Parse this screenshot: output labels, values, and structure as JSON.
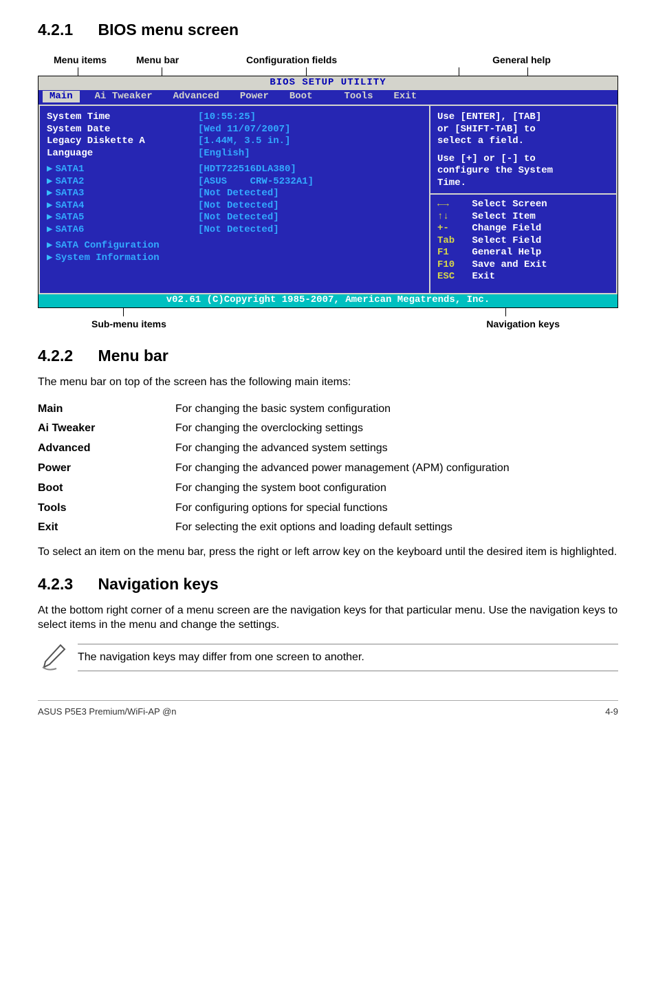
{
  "section1": {
    "num": "4.2.1",
    "title": "BIOS menu screen"
  },
  "topLabels": {
    "menuItems": "Menu items",
    "menuBar": "Menu bar",
    "configFields": "Configuration fields",
    "generalHelp": "General help"
  },
  "bios": {
    "title": "BIOS SETUP UTILITY",
    "tabs": {
      "main": "Main",
      "ai": "Ai Tweaker",
      "adv": "Advanced",
      "power": "Power",
      "boot": "Boot",
      "tools": "Tools",
      "exit": "Exit"
    },
    "left": {
      "sysTime": {
        "k": "System Time",
        "v": "[10:55:25]"
      },
      "sysDate": {
        "k": "System Date",
        "v": "[Wed 11/07/2007]"
      },
      "legacy": {
        "k": "Legacy Diskette A",
        "v": "[1.44M, 3.5 in.]"
      },
      "lang": {
        "k": "Language",
        "v": "[English]"
      },
      "sata1": {
        "k": "SATA1",
        "v": "[HDT722516DLA380]"
      },
      "sata2": {
        "k": "SATA2",
        "v": "[ASUS    CRW-5232A1]"
      },
      "sata3": {
        "k": "SATA3",
        "v": "[Not Detected]"
      },
      "sata4": {
        "k": "SATA4",
        "v": "[Not Detected]"
      },
      "sata5": {
        "k": "SATA5",
        "v": "[Not Detected]"
      },
      "sata6": {
        "k": "SATA6",
        "v": "[Not Detected]"
      },
      "sataCfg": "SATA Configuration",
      "sysInfo": "System Information"
    },
    "right": {
      "help1": "Use [ENTER], [TAB]",
      "help2": "or [SHIFT-TAB] to",
      "help3": "select a field.",
      "help4": "Use [+] or [-] to",
      "help5": "configure the System",
      "help6": "Time.",
      "nav": {
        "selScreen": "Select Screen",
        "selItem": "Select Item",
        "chField": "Change Field",
        "selField": "Select Field",
        "genHelp": "General Help",
        "saveExit": "Save and Exit",
        "exit": "Exit",
        "k_lr": "←→",
        "k_ud": "↑↓",
        "k_pm": "+-",
        "k_tab": "Tab",
        "k_f1": "F1",
        "k_f10": "F10",
        "k_esc": "ESC"
      }
    },
    "footer": "v02.61 (C)Copyright 1985-2007, American Megatrends, Inc."
  },
  "subLabels": {
    "sub": "Sub-menu items",
    "nav": "Navigation keys"
  },
  "section2": {
    "num": "4.2.2",
    "title": "Menu bar"
  },
  "s2p": "The menu bar on top of the screen has the following main items:",
  "defs": {
    "main": {
      "t": "Main",
      "d": "For changing the basic system configuration"
    },
    "ai": {
      "t": "Ai Tweaker",
      "d": "For changing the overclocking settings"
    },
    "adv": {
      "t": "Advanced",
      "d": "For changing the advanced system settings"
    },
    "power": {
      "t": "Power",
      "d": "For changing the advanced power management (APM) configuration"
    },
    "boot": {
      "t": "Boot",
      "d": "For changing the system boot configuration"
    },
    "tools": {
      "t": "Tools",
      "d": "For configuring options for special functions"
    },
    "exit": {
      "t": "Exit",
      "d": "For selecting the exit options and loading default settings"
    }
  },
  "s2p2": "To select an item on the menu bar, press the right or left arrow key on the keyboard until the desired item is highlighted.",
  "section3": {
    "num": "4.2.3",
    "title": "Navigation keys"
  },
  "s3p": "At the bottom right corner of a menu screen are the navigation keys for that particular menu. Use the navigation keys to select items in the menu and change the settings.",
  "note": "The navigation keys may differ from one screen to another.",
  "footer": {
    "left": "ASUS P5E3 Premium/WiFi-AP @n",
    "right": "4-9"
  }
}
